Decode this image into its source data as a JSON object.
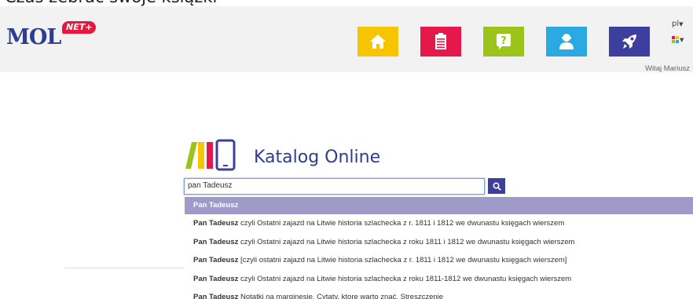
{
  "cropped_heading": "Czas zebrać swoje książki",
  "logo": {
    "text": "MOL",
    "badge": "NET+"
  },
  "nav": {
    "tiles": [
      {
        "name": "home",
        "color": "#f7c400",
        "icon": "home-icon"
      },
      {
        "name": "list",
        "color": "#e5174b",
        "icon": "document-list-icon"
      },
      {
        "name": "help",
        "color": "#9cc31a",
        "icon": "question-bubble-icon"
      },
      {
        "name": "user",
        "color": "#2aa9e3",
        "icon": "user-icon"
      },
      {
        "name": "rocket",
        "color": "#3c3f9e",
        "icon": "rocket-icon"
      }
    ],
    "language": "pl",
    "theme_colors": [
      "#e5174b",
      "#f7c400",
      "#9cc31a",
      "#2aa9e3"
    ]
  },
  "welcome": "Witaj Mariusz",
  "catalog": {
    "title": "Katalog Online"
  },
  "search": {
    "value": "pan Tadeusz",
    "button_icon": "search-icon",
    "accent": "#3c3f9e"
  },
  "suggestions": [
    {
      "bold": "Pan Tadeusz",
      "rest": ""
    },
    {
      "bold": "Pan Tadeusz",
      "rest": " czyli Ostatni zajazd na Litwie historia szlachecka z r. 1811 i 1812 we dwunastu księgach wierszem"
    },
    {
      "bold": "Pan Tadeusz",
      "rest": " czyli Ostatni zajazd na Litwie historia szlachecka z roku 1811 i 1812 we dwunastu księgach wierszem"
    },
    {
      "bold": "Pan Tadeusz",
      "rest": " [czyli ostatni zajazd na Litwie historia szlachecka z r. 1811 i 1812 we dwunastu księgach wierszem]"
    },
    {
      "bold": "Pan Tadeusz",
      "rest": " czyli Ostatni zajazd na Litwie historia szlachecka z roku 1811-1812 we dwunastu księgach wierszem"
    },
    {
      "bold": "Pan Tadeusz",
      "rest": " Notatki na marginesie. Cytaty, ktore warto znać. Streszczenie"
    }
  ]
}
